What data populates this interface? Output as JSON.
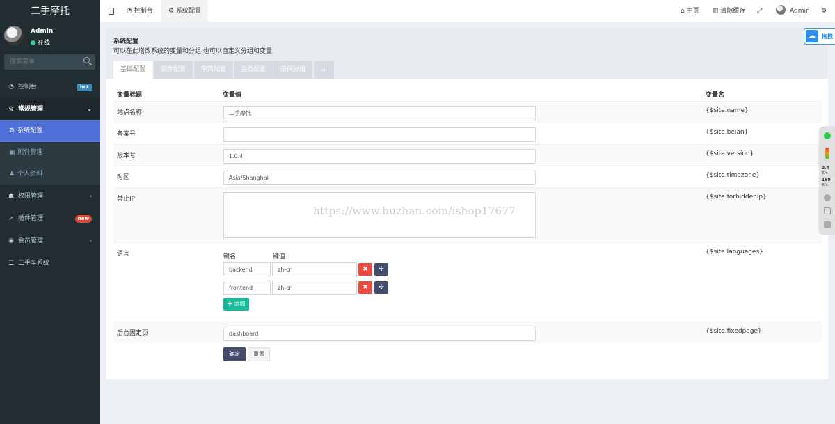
{
  "sidebar": {
    "logo": "二手摩托",
    "user_name": "Admin",
    "user_status": "在线",
    "search_placeholder": "搜索菜单",
    "menu": {
      "dashboard": {
        "label": "控制台",
        "badge": "hot",
        "icon": "dashboard-icon"
      },
      "general": {
        "label": "常规管理",
        "icon": "cogs-icon"
      },
      "sub_config": {
        "label": "系统配置",
        "icon": "cog-icon"
      },
      "sub_attachment": {
        "label": "附件管理",
        "icon": "file-image-icon"
      },
      "sub_profile": {
        "label": "个人资料",
        "icon": "user-icon"
      },
      "auth": {
        "label": "权限管理",
        "icon": "group-icon"
      },
      "addon": {
        "label": "插件管理",
        "badge": "new",
        "icon": "rocket-icon"
      },
      "member": {
        "label": "会员管理",
        "icon": "user-circle-icon"
      },
      "usedcar": {
        "label": "二手车系统",
        "icon": "list-icon"
      }
    }
  },
  "topbar": {
    "tabs": {
      "dashboard": "控制台",
      "config": "系统配置"
    },
    "home": "主页",
    "clear_cache": "清除缓存",
    "user": "Admin"
  },
  "float_share": {
    "label": "拖拽"
  },
  "side_panel": {
    "num1": "2.4",
    "num2": "150",
    "unit": "K/s"
  },
  "content": {
    "title": "系统配置",
    "subtitle": "可以在此增改系统的变量和分组,也可以自定义分组和变量",
    "tabs": {
      "basic": "基础配置",
      "email": "邮件配置",
      "dictionary": "字典配置",
      "member": "会员配置",
      "example": "示例分组",
      "add": "+"
    },
    "headers": {
      "title": "变量标题",
      "value": "变量值",
      "name": "变量名"
    },
    "rows": {
      "name": {
        "label": "站点名称",
        "value": "二手摩托",
        "var": "{$site.name}"
      },
      "beian": {
        "label": "备案号",
        "value": "",
        "var": "{$site.beian}"
      },
      "version": {
        "label": "版本号",
        "value": "1.0.4",
        "var": "{$site.version}"
      },
      "timezone": {
        "label": "时区",
        "value": "Asia/Shanghai",
        "var": "{$site.timezone}"
      },
      "forbiddenip": {
        "label": "禁止IP",
        "value": "",
        "var": "{$site.forbiddenip}"
      },
      "languages": {
        "label": "语言",
        "var": "{$site.languages}",
        "key_head": "键名",
        "val_head": "键值",
        "items": [
          {
            "key": "backend",
            "value": "zh-cn"
          },
          {
            "key": "frontend",
            "value": "zh-cn"
          }
        ],
        "add": "添加"
      },
      "fixedpage": {
        "label": "后台固定页",
        "value": "dashboard",
        "var": "{$site.fixedpage}"
      }
    },
    "watermark": "https://www.huzhan.com/ishop17677",
    "buttons": {
      "submit": "确定",
      "reset": "重置"
    }
  }
}
